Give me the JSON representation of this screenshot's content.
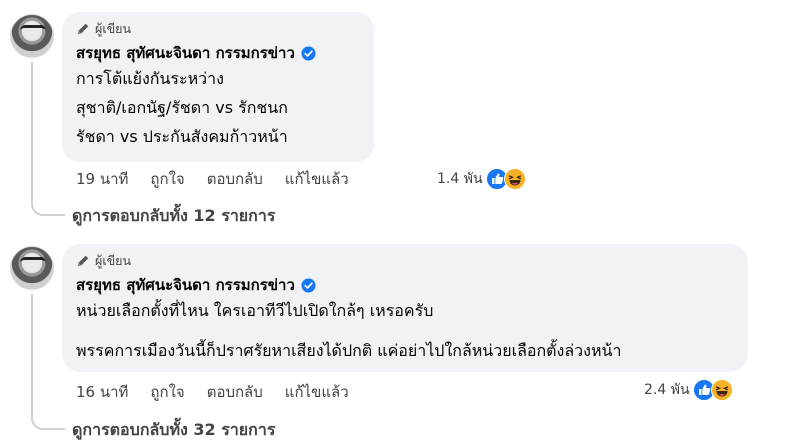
{
  "comments": [
    {
      "badge": "ผู้เขียน",
      "author": "สรยุทธ สุทัศนะจินดา กรรมกรข่าว",
      "lines": [
        "การโต้แย้งกันระหว่าง",
        "สุชาติ/เอกนัฐ/รัชดา vs รักชนก",
        "รัชดา vs ประกันสังคมก้าวหน้า"
      ],
      "time": "19 นาที",
      "like": "ถูกใจ",
      "reply": "ตอบกลับ",
      "edited": "แก้ไขแล้ว",
      "reaction_count": "1.4 พัน",
      "view_replies": "ดูการตอบกลับทั้ง 12 รายการ"
    },
    {
      "badge": "ผู้เขียน",
      "author": "สรยุทธ สุทัศนะจินดา กรรมกรข่าว",
      "lines": [
        "หน่วยเลือกตั้งที่ไหน ใครเอาทีวีไปเปิดใกล้ๆ เหรอครับ",
        "พรรคการเมืองวันนี้ก็ปราศรัยหาเสียงได้ปกติ แค่อย่าไปใกล้หน่วยเลือกตั้งล่วงหน้า"
      ],
      "time": "16 นาที",
      "like": "ถูกใจ",
      "reply": "ตอบกลับ",
      "edited": "แก้ไขแล้ว",
      "reaction_count": "2.4 พัน",
      "view_replies": "ดูการตอบกลับทั้ง 32 รายการ"
    }
  ],
  "icons": {
    "like": "like-reaction-icon",
    "haha": "haha-reaction-icon",
    "verified": "verified-badge-icon",
    "pencil": "pencil-icon"
  },
  "colors": {
    "bubble": "#f0f2f5",
    "like_blue": "#1877f2",
    "haha_yellow": "#f7b125",
    "text": "#050505",
    "muted": "#444444"
  }
}
